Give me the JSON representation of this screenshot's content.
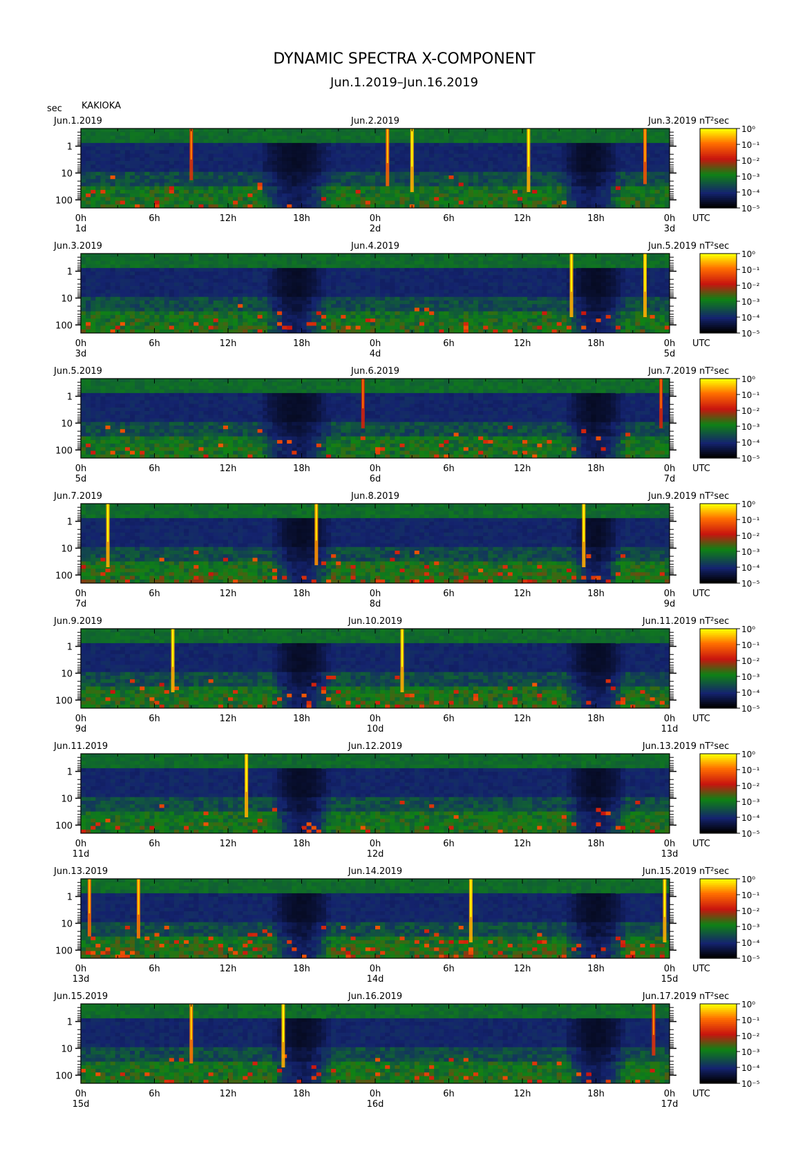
{
  "figure": {
    "title": "DYNAMIC SPECTRA X-COMPONENT",
    "subtitle": "Jun.1.2019–Jun.16.2019",
    "yaxis_unit": "sec",
    "station": "KAKIOKA"
  },
  "chart_data": {
    "type": "heatmap",
    "colorbar": {
      "unit": "nT²sec",
      "ticks": [
        "10⁰",
        "10⁻¹",
        "10⁻²",
        "10⁻³",
        "10⁻⁴",
        "10⁻⁵"
      ],
      "colors": [
        "#ffff00",
        "#ff7000",
        "#d01010",
        "#109010",
        "#102a70",
        "#000000"
      ]
    },
    "yaxis": {
      "labels": [
        "1",
        "10",
        "100"
      ],
      "scale": "log",
      "label": "sec"
    },
    "x_tick_labels": [
      "0h",
      "6h",
      "12h",
      "18h",
      "0h",
      "6h",
      "12h",
      "18h",
      "0h"
    ],
    "utc_label": "UTC",
    "panels": [
      {
        "date_left": "Jun.1.2019",
        "date_mid": "Jun.2.2019",
        "date_right": "Jun.3.2019",
        "day_start": "1d",
        "day_mid": "2d",
        "day_end": "3d",
        "mid_hour_label": "0h",
        "spikes": [
          {
            "hour": 9.0,
            "top": 0.0,
            "strength": 0.4
          },
          {
            "hour": 25.0,
            "top": 0.0,
            "strength": 0.7
          },
          {
            "hour": 27.0,
            "top": 0.0,
            "strength": 1.0
          },
          {
            "hour": 36.5,
            "top": 0.0,
            "strength": 1.0
          },
          {
            "hour": 46.0,
            "top": 0.0,
            "strength": 0.6
          }
        ],
        "quiet": [
          {
            "center": 17.5,
            "width": 6
          },
          {
            "center": 41.5,
            "width": 5
          }
        ],
        "activity": 0.45
      },
      {
        "date_left": "Jun.3.2019",
        "date_mid": "Jun.4.2019",
        "date_right": "Jun.5.2019",
        "day_start": "3d",
        "day_mid": "4d",
        "day_end": "5d",
        "mid_hour_label": "0h",
        "spikes": [
          {
            "hour": 40.0,
            "top": 0.0,
            "strength": 1.0
          },
          {
            "hour": 46.0,
            "top": 0.0,
            "strength": 1.0
          }
        ],
        "quiet": [
          {
            "center": 17.5,
            "width": 5
          },
          {
            "center": 42,
            "width": 5
          }
        ],
        "activity": 0.55
      },
      {
        "date_left": "Jun.5.2019",
        "date_mid": "Jun.6.2019",
        "date_right": "Jun.7.2019",
        "day_start": "5d",
        "day_mid": "6d",
        "day_end": "7d",
        "mid_hour_label": "0h",
        "spikes": [
          {
            "hour": 23.0,
            "top": 0.0,
            "strength": 0.3
          },
          {
            "hour": 47.3,
            "top": 0.0,
            "strength": 0.3
          }
        ],
        "quiet": [
          {
            "center": 17.5,
            "width": 6
          },
          {
            "center": 42,
            "width": 5
          }
        ],
        "activity": 0.35
      },
      {
        "date_left": "Jun.7.2019",
        "date_mid": "Jun.8.2019",
        "date_right": "Jun.9.2019",
        "day_start": "7d",
        "day_mid": "8d",
        "day_end": "9d",
        "mid_hour_label": "0h",
        "spikes": [
          {
            "hour": 2.2,
            "top": 0.0,
            "strength": 1.0
          },
          {
            "hour": 19.2,
            "top": 0.0,
            "strength": 0.9
          },
          {
            "hour": 41.0,
            "top": 0.0,
            "strength": 1.0
          }
        ],
        "quiet": [
          {
            "center": 18,
            "width": 5
          },
          {
            "center": 42,
            "width": 4
          }
        ],
        "activity": 0.8
      },
      {
        "date_left": "Jun.9.2019",
        "date_mid": "Jun.10.2019",
        "date_right": "Jun.11.2019",
        "day_start": "9d",
        "day_mid": "10d",
        "day_end": "11d",
        "mid_hour_label": "0h",
        "spikes": [
          {
            "hour": 7.5,
            "top": 0.0,
            "strength": 1.0
          },
          {
            "hour": 26.2,
            "top": 0.0,
            "strength": 1.0
          }
        ],
        "quiet": [
          {
            "center": 18,
            "width": 5
          },
          {
            "center": 42,
            "width": 5
          }
        ],
        "activity": 0.55
      },
      {
        "date_left": "Jun.11.2019",
        "date_mid": "Jun.12.2019",
        "date_right": "Jun.13.2019",
        "day_start": "11d",
        "day_mid": "12d",
        "day_end": "13d",
        "mid_hour_label": "0h",
        "spikes": [
          {
            "hour": 13.5,
            "top": 0.0,
            "strength": 1.0
          }
        ],
        "quiet": [
          {
            "center": 18,
            "width": 5
          },
          {
            "center": 42,
            "width": 5
          }
        ],
        "activity": 0.45
      },
      {
        "date_left": "Jun.13.2019",
        "date_mid": "Jun.14.2019",
        "date_right": "Jun.15.2019",
        "day_start": "13d",
        "day_mid": "14d",
        "day_end": "15d",
        "mid_hour_label": "0h",
        "spikes": [
          {
            "hour": 0.7,
            "top": 0.0,
            "strength": 0.7
          },
          {
            "hour": 4.7,
            "top": 0.0,
            "strength": 0.8
          },
          {
            "hour": 31.8,
            "top": 0.0,
            "strength": 1.0
          },
          {
            "hour": 47.6,
            "top": 0.0,
            "strength": 1.0
          }
        ],
        "quiet": [
          {
            "center": 18,
            "width": 5
          },
          {
            "center": 42,
            "width": 5
          }
        ],
        "activity": 0.85
      },
      {
        "date_left": "Jun.15.2019",
        "date_mid": "Jun.16.2019",
        "date_right": "Jun.17.2019",
        "day_start": "15d",
        "day_mid": "16d",
        "day_end": "17d",
        "mid_hour_label": "0h",
        "spikes": [
          {
            "hour": 9.0,
            "top": 0.0,
            "strength": 0.8
          },
          {
            "hour": 16.5,
            "top": 0.0,
            "strength": 1.0
          },
          {
            "hour": 46.7,
            "top": 0.0,
            "strength": 0.4
          }
        ],
        "quiet": [
          {
            "center": 18,
            "width": 5
          },
          {
            "center": 42,
            "width": 5
          }
        ],
        "activity": 0.6
      }
    ]
  }
}
